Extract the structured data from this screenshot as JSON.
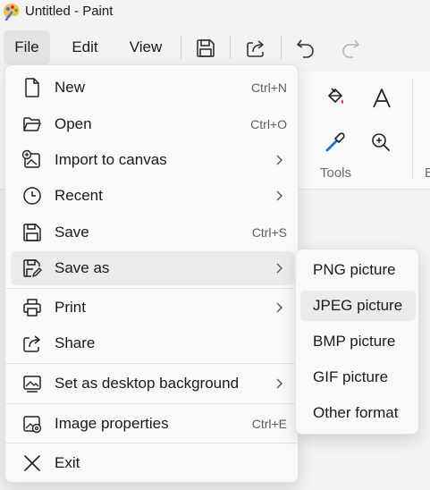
{
  "window": {
    "title": "Untitled - Paint"
  },
  "menubar": {
    "file": "File",
    "edit": "Edit",
    "view": "View",
    "icons": [
      "save-icon",
      "share-icon",
      "undo-icon",
      "redo-icon"
    ]
  },
  "ribbon": {
    "tools_label": "Tools",
    "edge_label": "B"
  },
  "file_menu": {
    "items": [
      {
        "label": "New",
        "shortcut": "Ctrl+N",
        "icon": "new-file-icon"
      },
      {
        "label": "Open",
        "shortcut": "Ctrl+O",
        "icon": "folder-icon"
      },
      {
        "label": "Import to canvas",
        "icon": "import-image-icon",
        "submenu": true
      },
      {
        "label": "Recent",
        "icon": "clock-icon",
        "submenu": true
      },
      {
        "label": "Save",
        "shortcut": "Ctrl+S",
        "icon": "save-icon"
      },
      {
        "label": "Save as",
        "icon": "save-as-icon",
        "submenu": true,
        "highlighted": true
      },
      {
        "label": "Print",
        "icon": "printer-icon",
        "submenu": true
      },
      {
        "label": "Share",
        "icon": "share-icon"
      },
      {
        "label": "Set as desktop background",
        "icon": "desktop-background-icon",
        "submenu": true
      },
      {
        "label": "Image properties",
        "shortcut": "Ctrl+E",
        "icon": "image-properties-icon"
      },
      {
        "label": "Exit",
        "icon": "close-icon"
      }
    ]
  },
  "save_as_submenu": {
    "items": [
      {
        "label": "PNG picture"
      },
      {
        "label": "JPEG picture",
        "highlighted": true
      },
      {
        "label": "BMP picture"
      },
      {
        "label": "GIF picture"
      },
      {
        "label": "Other format"
      }
    ]
  },
  "colors": {
    "accent_blue": "#1f6fd1",
    "paint_red": "#d13438"
  }
}
